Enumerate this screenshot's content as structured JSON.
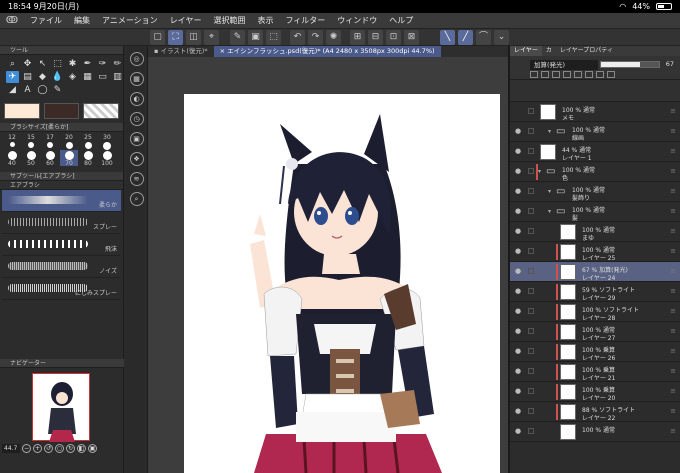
{
  "status": {
    "time": "18:54",
    "date": "9月20日(月)",
    "battery": "44%",
    "battery_level": 0.44
  },
  "menu": [
    "ファイル",
    "編集",
    "アニメーション",
    "レイヤー",
    "選択範囲",
    "表示",
    "フィルター",
    "ウィンドウ",
    "ヘルプ"
  ],
  "tabs": [
    {
      "label": "▪ イラスト(復元)*"
    },
    {
      "label": "× エイシンフラッシュ.psd(復元)* (A4 2480 x 3508px 300dpi 44.7%)"
    }
  ],
  "left": {
    "tool_header": "ツール",
    "brush_header": "ブラシサイズ[柔らか]",
    "subtool_header": "サブツール[エアブラシ]",
    "subtool_tab": "エアブラシ",
    "navigator_header": "ナビゲーター",
    "zoom": "44.7",
    "sizes": [
      "12",
      "15",
      "17",
      "20",
      "25",
      "30",
      "40",
      "50",
      "60",
      "70",
      "80",
      "100"
    ],
    "subtools": [
      "柔らか",
      "スプレー",
      "飛沫",
      "ノイズ",
      "にじみスプレー"
    ],
    "colors": {
      "main": "#fde9d6",
      "sub": "#3b2a25"
    }
  },
  "right": {
    "tabs": [
      "レイヤー",
      "カ",
      "レイヤープロパティ"
    ],
    "blend_mode": "加算(発光)",
    "opacity": "67",
    "opacity_level": 0.67,
    "layers": [
      {
        "l1": "100 % 通常",
        "l2": "メモ",
        "indent": 0,
        "kind": "layer",
        "eye": "",
        "clip": false
      },
      {
        "l1": "100 % 通常",
        "l2": "線画",
        "indent": 1,
        "kind": "folder",
        "eye": "●",
        "clip": false
      },
      {
        "l1": "44 % 通常",
        "l2": "レイヤー 1",
        "indent": 0,
        "kind": "layer",
        "eye": "●",
        "clip": false
      },
      {
        "l1": "100 % 通常",
        "l2": "色",
        "indent": 0,
        "kind": "folder",
        "eye": "●",
        "clip": true
      },
      {
        "l1": "100 % 通常",
        "l2": "髪飾り",
        "indent": 1,
        "kind": "folder",
        "eye": "●",
        "clip": false
      },
      {
        "l1": "100 % 通常",
        "l2": "髪",
        "indent": 1,
        "kind": "folder",
        "eye": "●",
        "clip": false
      },
      {
        "l1": "100 % 通常",
        "l2": "まゆ",
        "indent": 2,
        "kind": "layer",
        "eye": "●",
        "clip": false
      },
      {
        "l1": "100 % 通常",
        "l2": "レイヤー 25",
        "indent": 2,
        "kind": "layer",
        "eye": "●",
        "clip": true
      },
      {
        "l1": "67 % 加算(発光)",
        "l2": "レイヤー 24",
        "indent": 2,
        "kind": "layer",
        "eye": "●",
        "clip": true,
        "selected": true
      },
      {
        "l1": "59 % ソフトライト",
        "l2": "レイヤー 29",
        "indent": 2,
        "kind": "layer",
        "eye": "●",
        "clip": true
      },
      {
        "l1": "100 % ソフトライト",
        "l2": "レイヤー 28",
        "indent": 2,
        "kind": "layer",
        "eye": "●",
        "clip": true
      },
      {
        "l1": "100 % 通常",
        "l2": "レイヤー 27",
        "indent": 2,
        "kind": "layer",
        "eye": "●",
        "clip": true
      },
      {
        "l1": "100 % 乗算",
        "l2": "レイヤー 26",
        "indent": 2,
        "kind": "layer",
        "eye": "●",
        "clip": true
      },
      {
        "l1": "100 % 乗算",
        "l2": "レイヤー 21",
        "indent": 2,
        "kind": "layer",
        "eye": "●",
        "clip": true
      },
      {
        "l1": "100 % 乗算",
        "l2": "レイヤー 20",
        "indent": 2,
        "kind": "layer",
        "eye": "●",
        "clip": true
      },
      {
        "l1": "88 % ソフトライト",
        "l2": "レイヤー 22",
        "indent": 2,
        "kind": "layer",
        "eye": "●",
        "clip": true
      },
      {
        "l1": "100 % 通常",
        "l2": "",
        "indent": 2,
        "kind": "layer",
        "eye": "●",
        "clip": false
      }
    ]
  }
}
